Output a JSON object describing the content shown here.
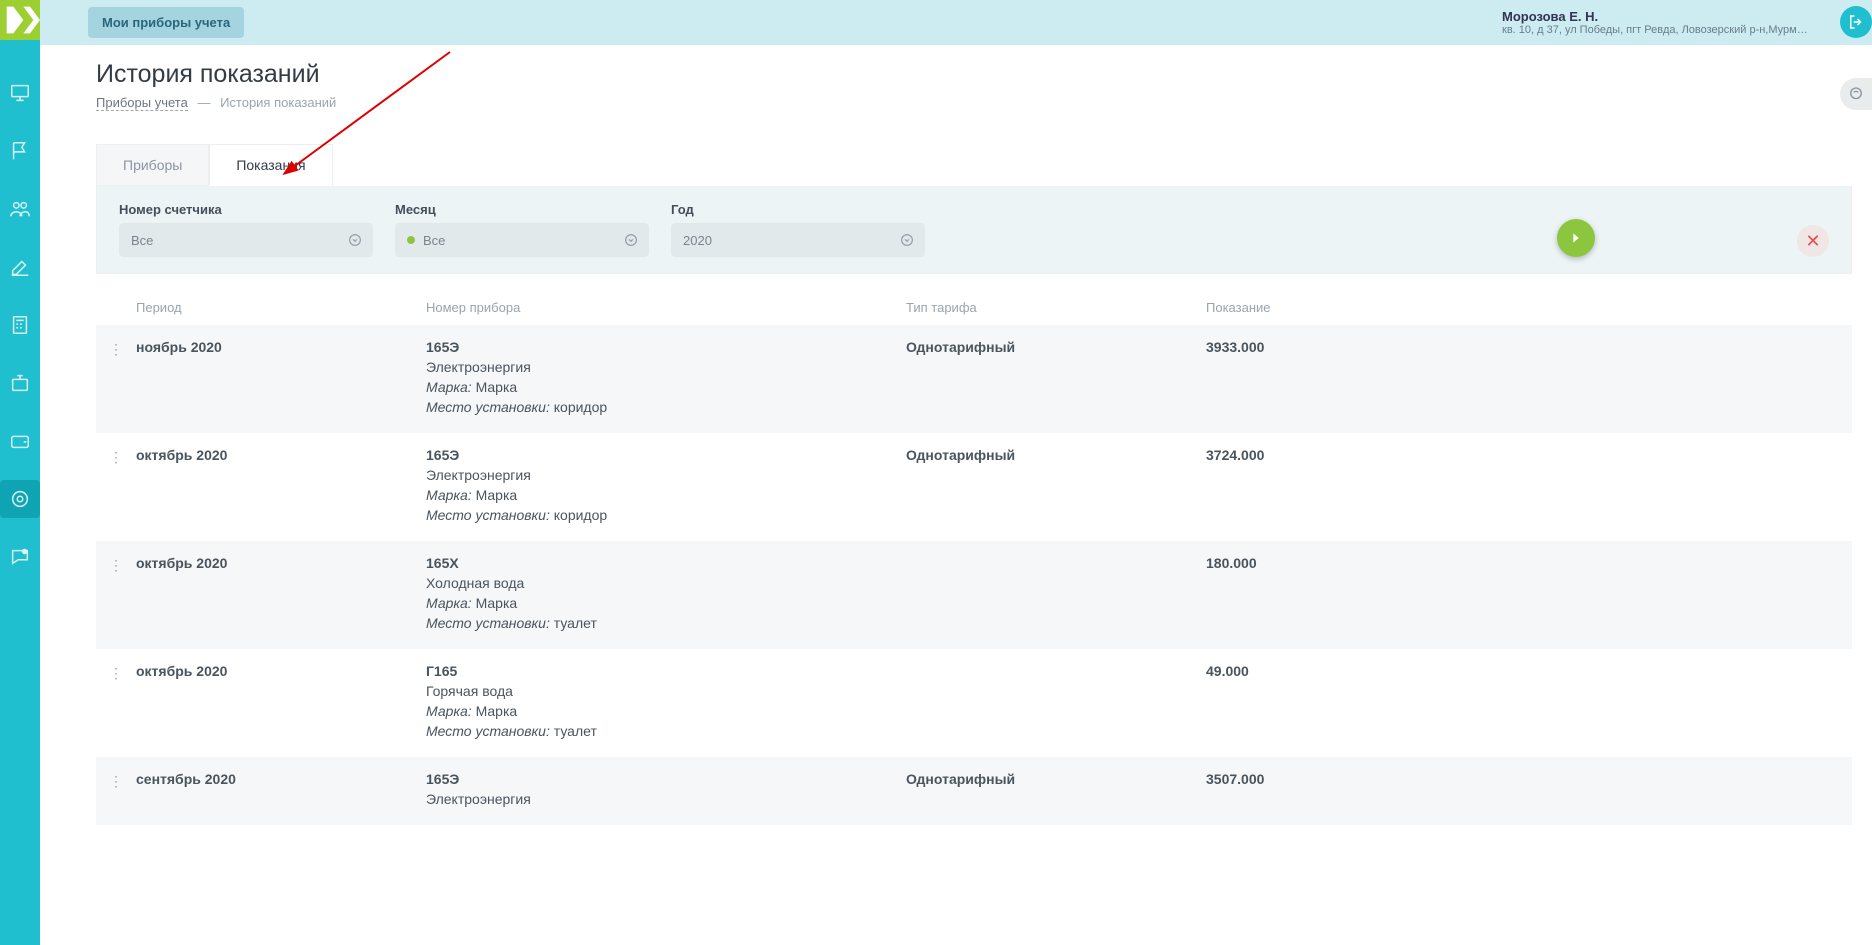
{
  "topbar": {
    "button_label": "Мои приборы учета",
    "user_name": "Морозова Е. Н.",
    "user_address": "кв. 10, д 37, ул Победы, пгт Ревда, Ловозерский р-н,Мурманская ..."
  },
  "page": {
    "title": "История показаний",
    "breadcrumb_link": "Приборы учета",
    "breadcrumb_sep": "—",
    "breadcrumb_current": "История показаний"
  },
  "tabs": {
    "devices": "Приборы",
    "readings": "Показания"
  },
  "filters": {
    "meter_label": "Номер счетчика",
    "meter_value": "Все",
    "month_label": "Месяц",
    "month_value": "Все",
    "year_label": "Год",
    "year_value": "2020"
  },
  "columns": {
    "period": "Период",
    "device": "Номер прибора",
    "tariff": "Тип тарифа",
    "reading": "Показание"
  },
  "device_labels": {
    "brand": "Марка:",
    "place": "Место установки:"
  },
  "rows": [
    {
      "period": "ноябрь 2020",
      "num": "165Э",
      "type": "Электроэнергия",
      "brand": "Марка",
      "place": "коридор",
      "tariff": "Однотарифный",
      "reading": "3933.000"
    },
    {
      "period": "октябрь 2020",
      "num": "165Э",
      "type": "Электроэнергия",
      "brand": "Марка",
      "place": "коридор",
      "tariff": "Однотарифный",
      "reading": "3724.000"
    },
    {
      "period": "октябрь 2020",
      "num": "165Х",
      "type": "Холодная вода",
      "brand": "Марка",
      "place": "туалет",
      "tariff": "",
      "reading": "180.000"
    },
    {
      "period": "октябрь 2020",
      "num": "Г165",
      "type": "Горячая вода",
      "brand": "Марка",
      "place": "туалет",
      "tariff": "",
      "reading": "49.000"
    },
    {
      "period": "сентябрь 2020",
      "num": "165Э",
      "type": "Электроэнергия",
      "brand": "",
      "place": "",
      "tariff": "Однотарифный",
      "reading": "3507.000"
    }
  ]
}
